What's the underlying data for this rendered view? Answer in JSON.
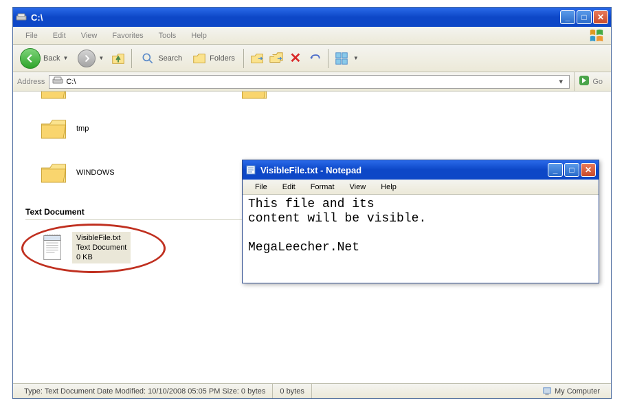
{
  "explorer": {
    "title": "C:\\",
    "menu": {
      "file": "File",
      "edit": "Edit",
      "view": "View",
      "favorites": "Favorites",
      "tools": "Tools",
      "help": "Help"
    },
    "toolbar": {
      "back": "Back",
      "search": "Search",
      "folders": "Folders"
    },
    "address": {
      "label": "Address",
      "value": "C:\\",
      "go": "Go"
    },
    "folders": [
      {
        "name": "tmp"
      },
      {
        "name": "WINDOWS"
      }
    ],
    "section_header": "Text Document",
    "file": {
      "name": "VisibleFile.txt",
      "type": "Text Document",
      "size": "0 KB"
    },
    "statusbar": {
      "details": "Type: Text Document Date Modified: 10/10/2008 05:05 PM Size: 0 bytes",
      "bytes": "0 bytes",
      "location": "My Computer"
    }
  },
  "notepad": {
    "title": "VisibleFile.txt - Notepad",
    "menu": {
      "file": "File",
      "edit": "Edit",
      "format": "Format",
      "view": "View",
      "help": "Help"
    },
    "content": "This file and its\ncontent will be visible.\n\nMegaLeecher.Net"
  }
}
